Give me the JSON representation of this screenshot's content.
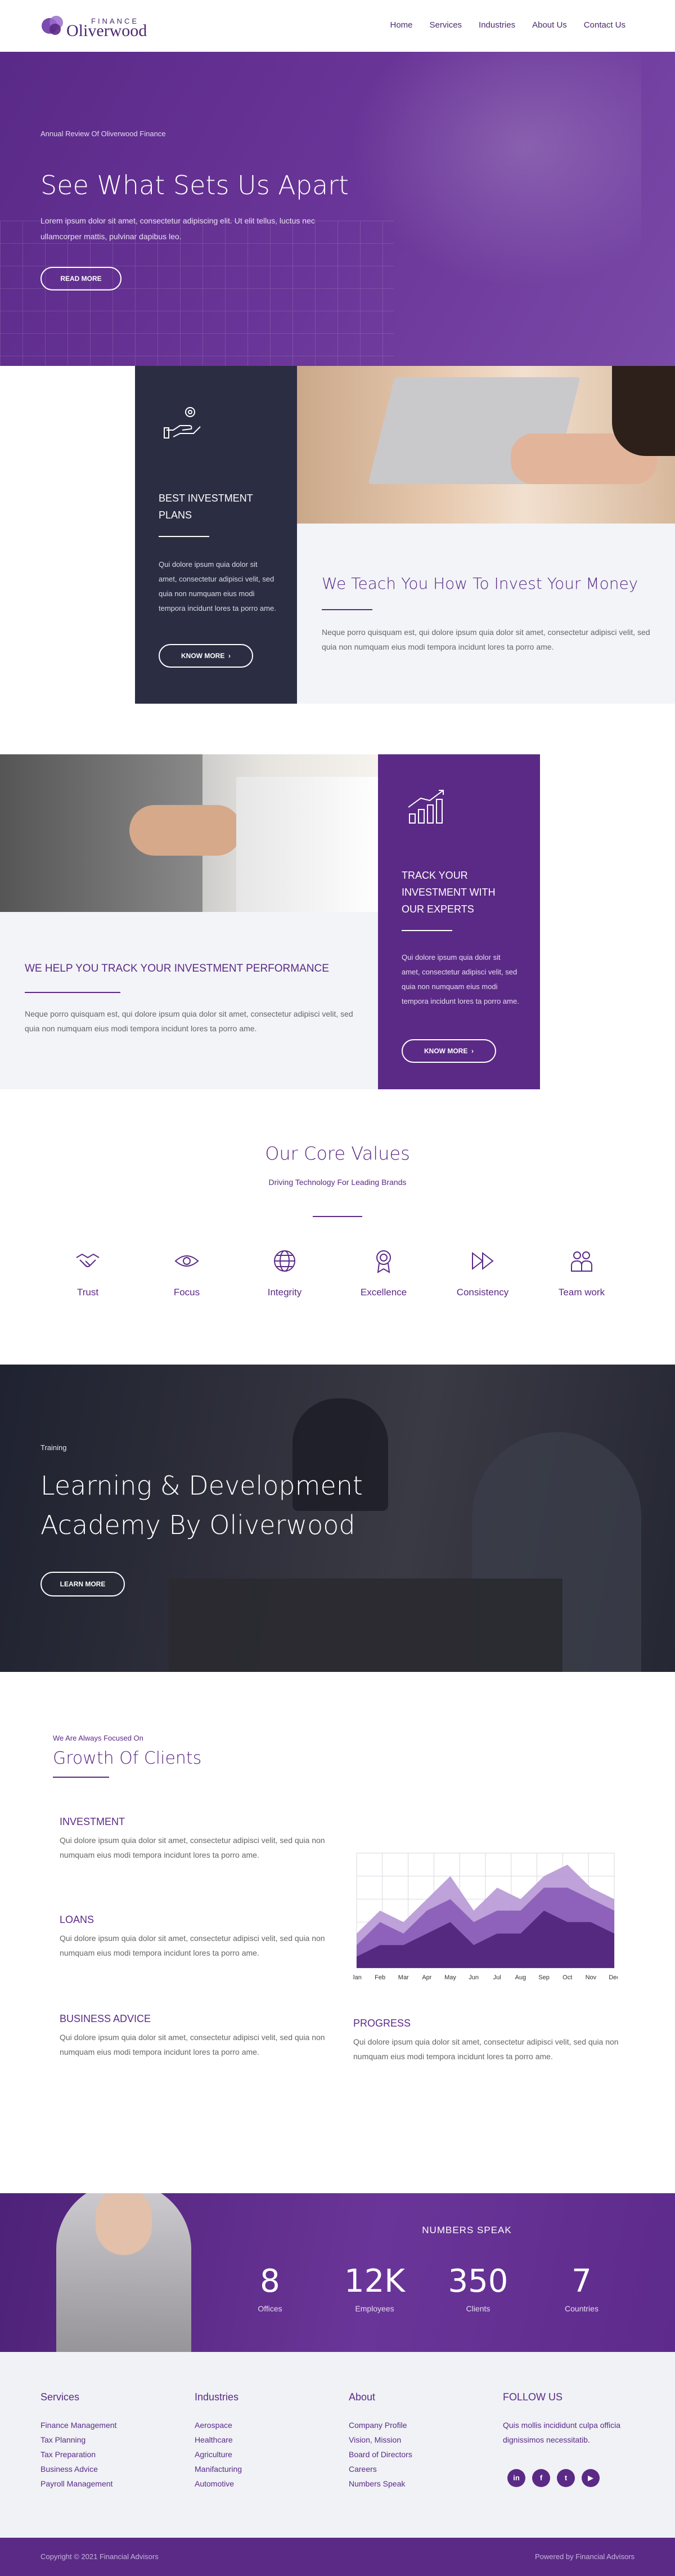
{
  "header": {
    "logo_top": "FINANCE",
    "logo_name": "Oliverwood",
    "nav": [
      "Home",
      "Services",
      "Industries",
      "About Us",
      "Contact Us"
    ]
  },
  "hero": {
    "eyebrow": "Annual Review Of Oliverwood Finance",
    "title": "See What Sets Us Apart",
    "text": "Lorem ipsum dolor sit amet, consectetur adipiscing elit. Ut elit tellus, luctus nec ullamcorper mattis, pulvinar dapibus leo.",
    "button": "READ MORE"
  },
  "investment_plans": {
    "title": "BEST INVESTMENT PLANS",
    "text": "Qui dolore ipsum quia dolor sit amet, consectetur adipisci velit, sed quia non numquam eius modi tempora incidunt lores ta porro ame.",
    "button": "KNOW MORE",
    "icon": "hand-coin-icon"
  },
  "teach": {
    "title": "We Teach You How To Invest Your Money",
    "text": "Neque porro quisquam est, qui dolore ipsum quia dolor sit amet, consectetur adipisci velit, sed quia non numquam eius modi tempora incidunt lores ta porro ame."
  },
  "track_performance": {
    "title": "WE HELP YOU TRACK YOUR INVESTMENT PERFORMANCE",
    "text": "Neque porro quisquam est, qui dolore ipsum quia dolor sit amet, consectetur adipisci velit, sed quia non numquam eius modi tempora incidunt lores ta porro ame."
  },
  "track_box": {
    "title": "TRACK YOUR INVESTMENT WITH OUR EXPERTS",
    "text": "Qui dolore ipsum quia dolor sit amet, consectetur adipisci velit, sed quia non numquam eius modi tempora incidunt lores ta porro ame.",
    "button": "KNOW MORE",
    "icon": "growth-chart-icon"
  },
  "core_values": {
    "title": "Our Core Values",
    "subtitle": "Driving Technology For Leading Brands",
    "items": [
      {
        "label": "Trust",
        "icon": "handshake-icon"
      },
      {
        "label": "Focus",
        "icon": "eye-icon"
      },
      {
        "label": "Integrity",
        "icon": "globe-icon"
      },
      {
        "label": "Excellence",
        "icon": "award-icon"
      },
      {
        "label": "Consistency",
        "icon": "fast-forward-icon"
      },
      {
        "label": "Team work",
        "icon": "team-icon"
      }
    ]
  },
  "academy": {
    "eyebrow": "Training",
    "title": "Learning & Development Academy By Oliverwood",
    "button": "LEARN MORE"
  },
  "growth": {
    "eyebrow": "We Are Always Focused On",
    "title": "Growth Of Clients",
    "items": [
      {
        "title": "INVESTMENT",
        "text": "Qui dolore ipsum quia dolor sit amet, consectetur adipisci velit, sed quia non numquam eius modi tempora incidunt lores ta porro ame."
      },
      {
        "title": "LOANS",
        "text": "Qui dolore ipsum quia dolor sit amet, consectetur adipisci velit, sed quia non numquam eius modi tempora incidunt lores ta porro ame."
      },
      {
        "title": "BUSINESS ADVICE",
        "text": "Qui dolore ipsum quia dolor sit amet, consectetur adipisci velit, sed quia non numquam eius modi tempora incidunt lores ta porro ame."
      }
    ],
    "progress": {
      "title": "PROGRESS",
      "text": "Qui dolore ipsum quia dolor sit amet, consectetur adipisci velit, sed quia non numquam eius modi tempora incidunt lores ta porro ame."
    }
  },
  "chart_data": {
    "type": "area",
    "categories": [
      "Jan",
      "Feb",
      "Mar",
      "Apr",
      "May",
      "Jun",
      "Jul",
      "Aug",
      "Sep",
      "Oct",
      "Nov",
      "Dec"
    ],
    "series": [
      {
        "values": [
          3,
          5,
          4,
          6,
          8,
          5,
          7,
          6,
          8,
          9,
          7,
          6
        ],
        "color": "#b89ad6"
      },
      {
        "values": [
          2,
          4,
          3,
          5,
          6,
          4,
          5,
          5,
          7,
          7,
          6,
          5
        ],
        "color": "#8a5cb8"
      },
      {
        "values": [
          1,
          2,
          2,
          3,
          4,
          2,
          3,
          3,
          5,
          4,
          4,
          3
        ],
        "color": "#4f2479"
      }
    ],
    "ylim": [
      0,
      10
    ],
    "grid": true,
    "title": "",
    "xlabel": "",
    "ylabel": ""
  },
  "numbers": {
    "title": "NUMBERS SPEAK",
    "items": [
      {
        "value": "8",
        "label": "Offices"
      },
      {
        "value": "12K",
        "label": "Employees"
      },
      {
        "value": "350",
        "label": "Clients"
      },
      {
        "value": "7",
        "label": "Countries"
      }
    ]
  },
  "footer": {
    "columns": [
      {
        "heading": "Services",
        "items": [
          "Finance Management",
          "Tax Planning",
          "Tax Preparation",
          "Business Advice",
          "Payroll Management"
        ]
      },
      {
        "heading": "Industries",
        "items": [
          "Aerospace",
          "Healthcare",
          "Agriculture",
          "Manifacturing",
          "Automotive"
        ]
      },
      {
        "heading": "About",
        "items": [
          "Company Profile",
          "Vision, Mission",
          "Board of Directors",
          "Careers",
          "Numbers Speak"
        ]
      }
    ],
    "follow": {
      "heading": "FOLLOW US",
      "text": "Quis mollis incididunt culpa officia dignissimos necessitatib.",
      "socials": [
        "linkedin-icon",
        "facebook-icon",
        "twitter-icon",
        "youtube-icon"
      ]
    },
    "copyright": "Copyright © 2021 Financial Advisors",
    "powered": "Powered by Financial Advisors"
  },
  "colors": {
    "brand": "#5b2a86",
    "dark": "#2b2d42",
    "light": "#f2f4f7"
  }
}
